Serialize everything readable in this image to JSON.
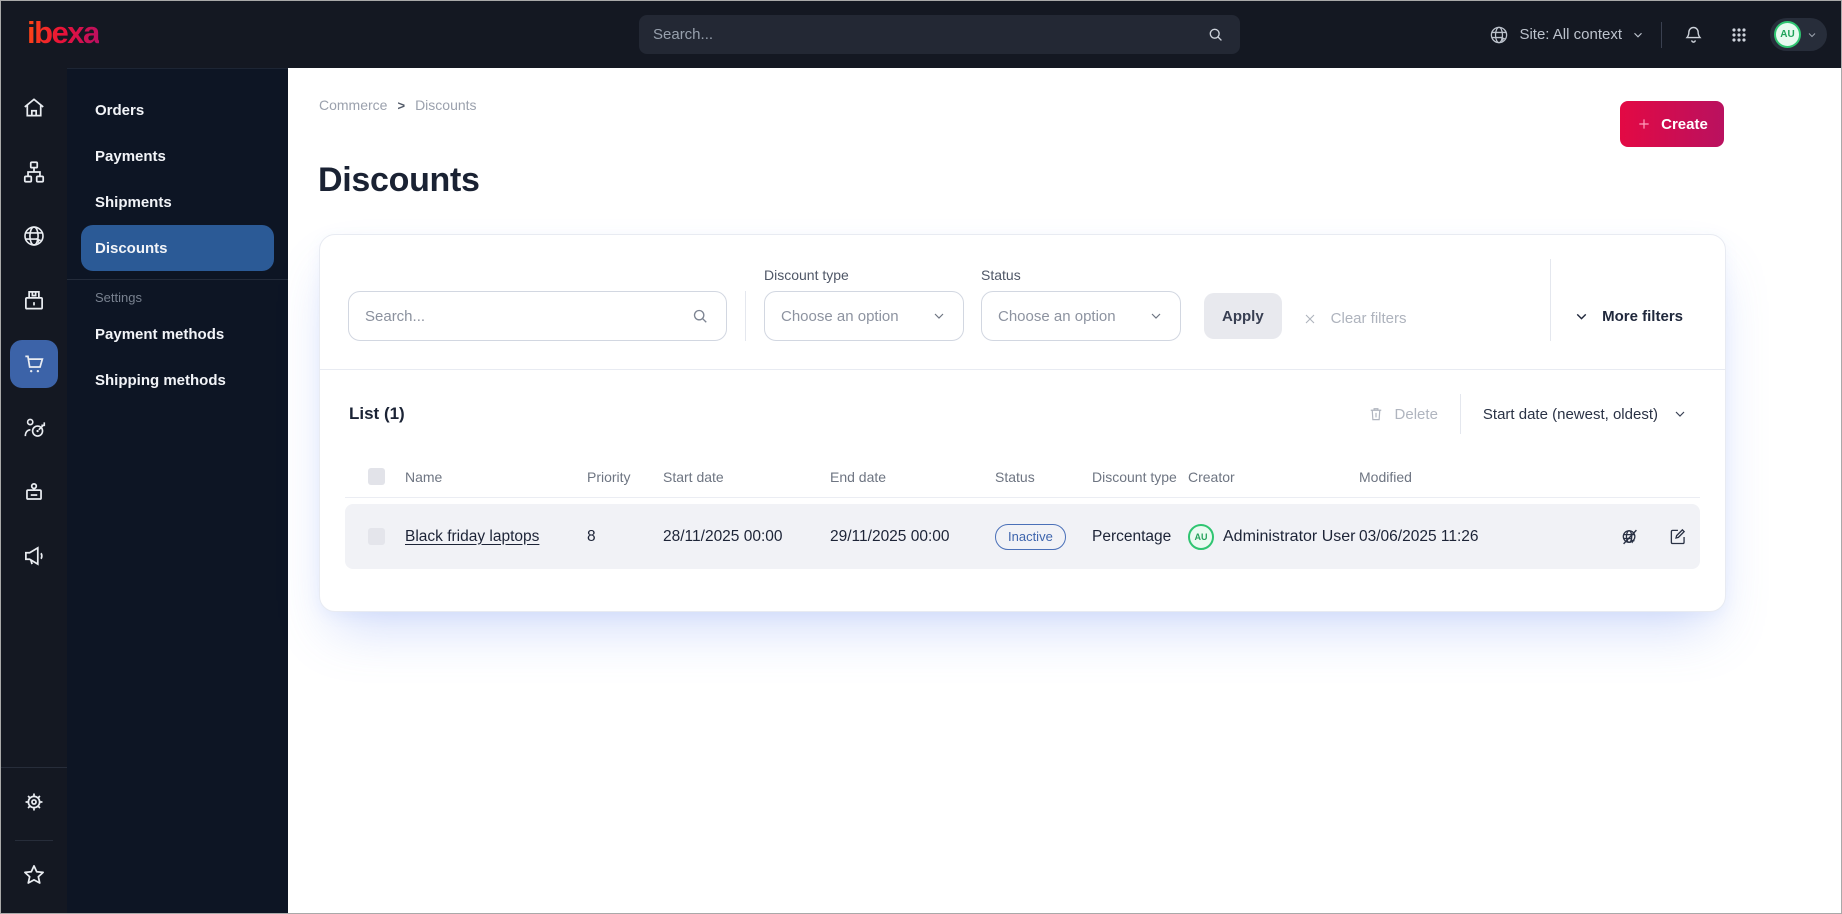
{
  "topbar": {
    "logo_text": "ibexa",
    "search_placeholder": "Search...",
    "site_context_label": "Site: All context",
    "avatar_initials": "AU"
  },
  "rail": {
    "items": [
      "home",
      "content-tree",
      "site",
      "products",
      "commerce-cart",
      "personalization",
      "users-badge",
      "marketing-megaphone",
      "settings-gear",
      "bookmarks-star"
    ],
    "active_item": "commerce-cart"
  },
  "sidebar": {
    "items": [
      "Orders",
      "Payments",
      "Shipments",
      "Discounts"
    ],
    "active_item": "Discounts",
    "section_label": "Settings",
    "settings_items": [
      "Payment methods",
      "Shipping methods"
    ]
  },
  "breadcrumb": {
    "items": [
      "Commerce",
      "Discounts"
    ],
    "separator": ">"
  },
  "page": {
    "title": "Discounts",
    "create_label": "Create"
  },
  "filters": {
    "search_placeholder": "Search...",
    "discount_type_label": "Discount type",
    "discount_type_value": "Choose an option",
    "status_label": "Status",
    "status_value": "Choose an option",
    "apply_label": "Apply",
    "clear_label": "Clear filters",
    "more_label": "More filters"
  },
  "list": {
    "title": "List (1)",
    "delete_label": "Delete",
    "sort_label": "Start date (newest, oldest)",
    "columns": [
      "Name",
      "Priority",
      "Start date",
      "End date",
      "Status",
      "Discount type",
      "Creator",
      "Modified"
    ],
    "rows": [
      {
        "name": "Black friday laptops",
        "priority": "8",
        "start_date": "28/11/2025 00:00",
        "end_date": "29/11/2025 00:00",
        "status": "Inactive",
        "discount_type": "Percentage",
        "creator": "Administrator User",
        "creator_initials": "AU",
        "modified": "03/06/2025 11:26"
      }
    ]
  },
  "colors": {
    "brand_accent": "#e30944",
    "active_blue": "#2b5a96",
    "status_inactive": "#4064ac",
    "avatar_green": "#27a35d",
    "topbar_bg": "#141822",
    "sidebar_bg": "#0d1524"
  }
}
